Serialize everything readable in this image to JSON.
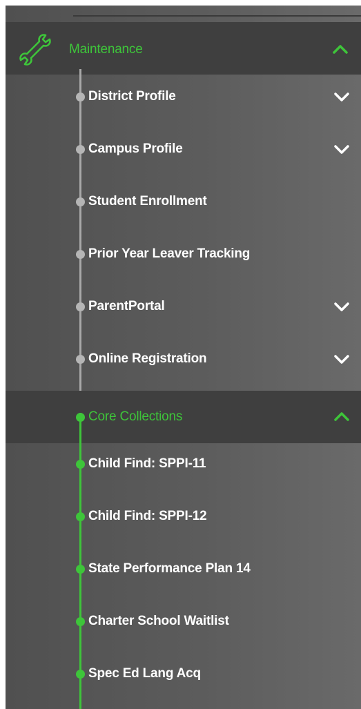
{
  "sidebar": {
    "maintenance": {
      "label": "Maintenance",
      "icon": "wrench-icon",
      "expanded": true,
      "items": [
        {
          "label": "District Profile",
          "has_submenu": true
        },
        {
          "label": "Campus Profile",
          "has_submenu": true
        },
        {
          "label": "Student Enrollment",
          "has_submenu": false
        },
        {
          "label": "Prior Year Leaver Tracking",
          "has_submenu": false
        },
        {
          "label": "ParentPortal",
          "has_submenu": true
        },
        {
          "label": "Online Registration",
          "has_submenu": true
        }
      ]
    },
    "core_collections": {
      "label": "Core Collections",
      "expanded": true,
      "items": [
        {
          "label": "Child Find: SPPI-11"
        },
        {
          "label": "Child Find: SPPI-12"
        },
        {
          "label": "State Performance Plan 14"
        },
        {
          "label": "Charter School Waitlist"
        },
        {
          "label": "Spec Ed Lang Acq"
        }
      ]
    }
  },
  "colors": {
    "accent_green": "#3ec53a",
    "sidebar_bg": "#595959",
    "header_bg": "#3f3f3f",
    "text": "#ffffff",
    "grey_line": "#a8a8a8"
  }
}
